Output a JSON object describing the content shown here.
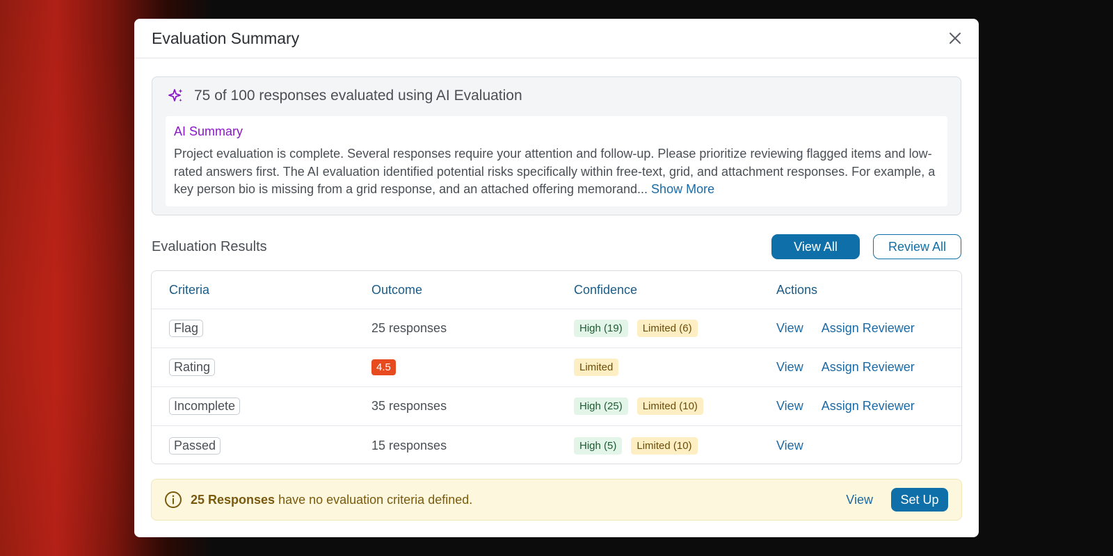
{
  "modal": {
    "title": "Evaluation Summary"
  },
  "ai_box": {
    "count_text": "75 of 100 responses evaluated using AI Evaluation",
    "summary_title": "AI Summary",
    "summary_text": "Project evaluation is complete. Several responses require your attention and follow-up. Please prioritize reviewing flagged items and low-rated answers first. The AI evaluation identified potential risks specifically within free-text, grid, and attachment responses. For example, a key person bio is missing from a grid response, and an attached offering memorand...",
    "show_more_label": "Show More"
  },
  "results": {
    "title": "Evaluation Results",
    "view_all_label": "View All",
    "review_all_label": "Review All",
    "columns": [
      "Criteria",
      "Outcome",
      "Confidence",
      "Actions"
    ],
    "rows": [
      {
        "criteria": "Flag",
        "outcome": "25 responses",
        "high": "High (19)",
        "limited": "Limited (6)",
        "view": "View",
        "assign": "Assign Reviewer"
      },
      {
        "criteria": "Rating",
        "score": "4.5",
        "limited": "Limited",
        "view": "View",
        "assign": "Assign Reviewer"
      },
      {
        "criteria": "Incomplete",
        "outcome": "35 responses",
        "high": "High (25)",
        "limited": "Limited (10)",
        "view": "View",
        "assign": "Assign Reviewer"
      },
      {
        "criteria": "Passed",
        "outcome": "15 responses",
        "high": "High (5)",
        "limited": "Limited (10)",
        "view": "View"
      }
    ]
  },
  "notice": {
    "bold_text": "25 Responses",
    "text": " have no evaluation criteria defined.",
    "view_label": "View",
    "setup_label": "Set Up"
  },
  "colors": {
    "accent": "#0f6fa8",
    "ai_purple": "#8a17c9",
    "score_orange": "#e64a1e",
    "high_bg": "#e2f5e8",
    "limited_bg": "#fdefc3",
    "notice_bg": "#fdf7dd"
  },
  "icons": {
    "ai": "sparkle-icon",
    "close": "close-icon",
    "notice": "info-icon"
  }
}
